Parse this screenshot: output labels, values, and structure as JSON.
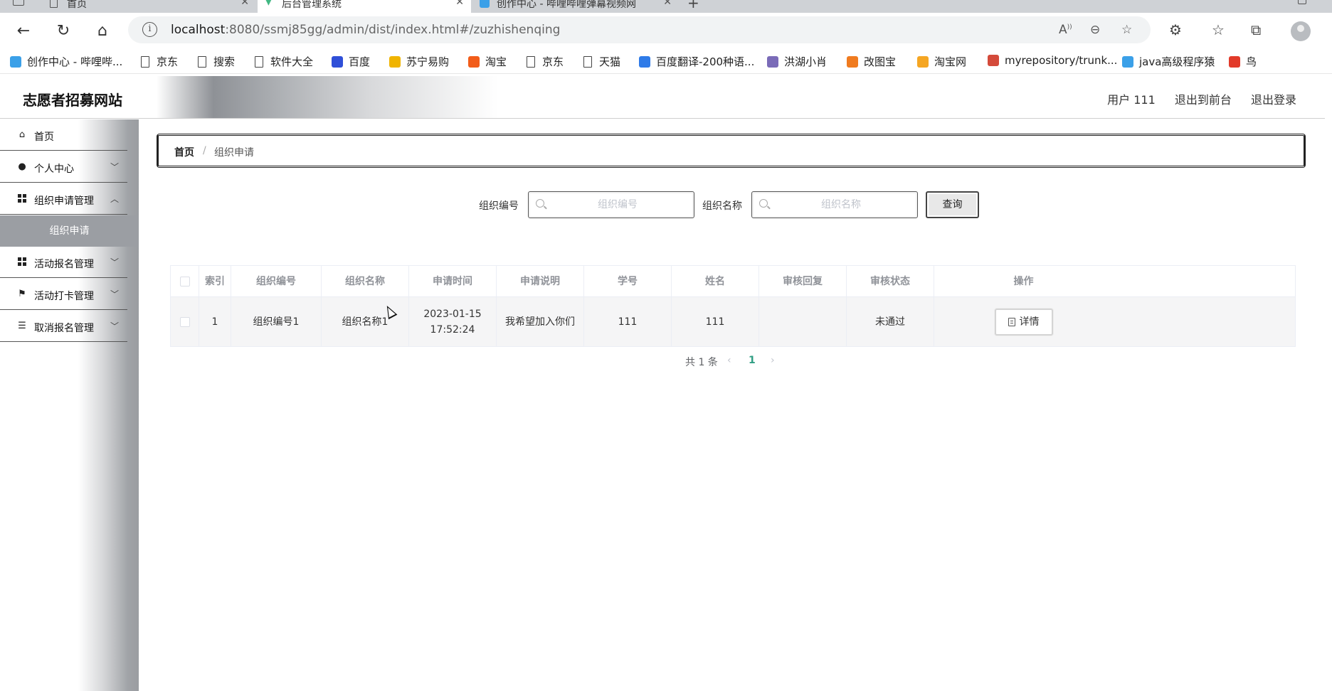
{
  "browser": {
    "tabs": [
      {
        "label": "首页"
      },
      {
        "label": "后台管理系统"
      },
      {
        "label": "创作中心 - 哔哩哔哩弹幕视频网"
      }
    ],
    "url_host": "localhost",
    "url_path": ":8080/ssmj85gg/admin/dist/index.html#/zuzhishenqing",
    "bookmarks": [
      {
        "label": "创作中心 - 哔哩哔...",
        "color": "#3ba0e8"
      },
      {
        "label": "京东",
        "color": ""
      },
      {
        "label": "搜索",
        "color": ""
      },
      {
        "label": "软件大全",
        "color": ""
      },
      {
        "label": "百度",
        "color": "#2f4fd8"
      },
      {
        "label": "苏宁易购",
        "color": "#f0b400"
      },
      {
        "label": "淘宝",
        "color": "#f25c19"
      },
      {
        "label": "京东",
        "color": ""
      },
      {
        "label": "天猫",
        "color": ""
      },
      {
        "label": "百度翻译-200种语...",
        "color": "#2f7be8"
      },
      {
        "label": "洪湖小肖",
        "color": "#7a6bb8"
      },
      {
        "label": "改图宝",
        "color": "#f07b1f"
      },
      {
        "label": "淘宝网",
        "color": "#f5a623"
      },
      {
        "label": "myrepository/trunk...",
        "color": "#d44a3a"
      },
      {
        "label": "java高级程序猿",
        "color": "#3ba0e8"
      },
      {
        "label": "鸟",
        "color": "#e23a2a"
      }
    ]
  },
  "header": {
    "title": "志愿者招募网站",
    "user_label": "用户 111",
    "front_link": "退出到前台",
    "logout_link": "退出登录"
  },
  "sidebar": {
    "items": [
      {
        "label": "首页",
        "icon": "home-icon"
      },
      {
        "label": "个人中心",
        "icon": "user-icon"
      },
      {
        "label": "组织申请管理",
        "icon": "grid-icon"
      },
      {
        "label": "组织申请",
        "icon": ""
      },
      {
        "label": "活动报名管理",
        "icon": "grid-icon"
      },
      {
        "label": "活动打卡管理",
        "icon": "flag-icon"
      },
      {
        "label": "取消报名管理",
        "icon": "sliders-icon"
      }
    ]
  },
  "breadcrumb": {
    "home": "首页",
    "separator": "/",
    "current": "组织申请"
  },
  "search": {
    "code_label": "组织编号",
    "code_placeholder": "组织编号",
    "name_label": "组织名称",
    "name_placeholder": "组织名称",
    "query_button": "查询"
  },
  "table": {
    "columns": [
      "索引",
      "组织编号",
      "组织名称",
      "申请时间",
      "申请说明",
      "学号",
      "姓名",
      "审核回复",
      "审核状态",
      "操作"
    ],
    "rows": [
      {
        "index": "1",
        "org_code": "组织编号1",
        "org_name": "组织名称1",
        "apply_time": "2023-01-15 17:52:24",
        "apply_note": "我希望加入你们",
        "student_no": "111",
        "name": "111",
        "review_reply": "",
        "review_status": "未通过",
        "action": "详情"
      }
    ]
  },
  "pagination": {
    "total": "共 1 条",
    "current_page": "1"
  }
}
